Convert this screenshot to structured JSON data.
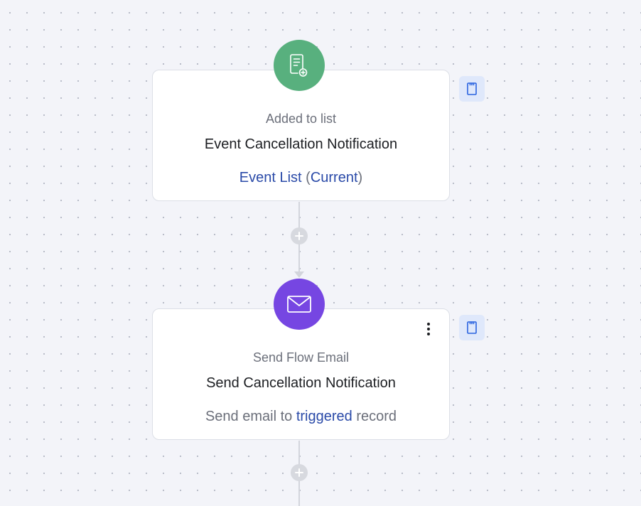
{
  "nodes": [
    {
      "type_label": "Added to list",
      "title": "Event Cancellation Notification",
      "detail": {
        "link1": "Event List",
        "paren_open": " (",
        "link2": "Current",
        "paren_close": ")"
      },
      "icon": "list-add-icon",
      "icon_color": "#58b07e"
    },
    {
      "type_label": "Send Flow Email",
      "title": "Send Cancellation Notification",
      "detail": {
        "prefix": "Send email to ",
        "link": "triggered",
        "suffix": " record"
      },
      "icon": "envelope-icon",
      "icon_color": "#7646e2",
      "menu_icon": "more-vertical-icon"
    }
  ],
  "side_buttons": [
    "notes-icon",
    "notes-icon"
  ],
  "connector_buttons": [
    "plus-icon",
    "plus-icon"
  ],
  "colors": {
    "canvas": "#f3f4f9",
    "link": "#2a4aa8",
    "note_button_bg": "#dfe8fb"
  }
}
